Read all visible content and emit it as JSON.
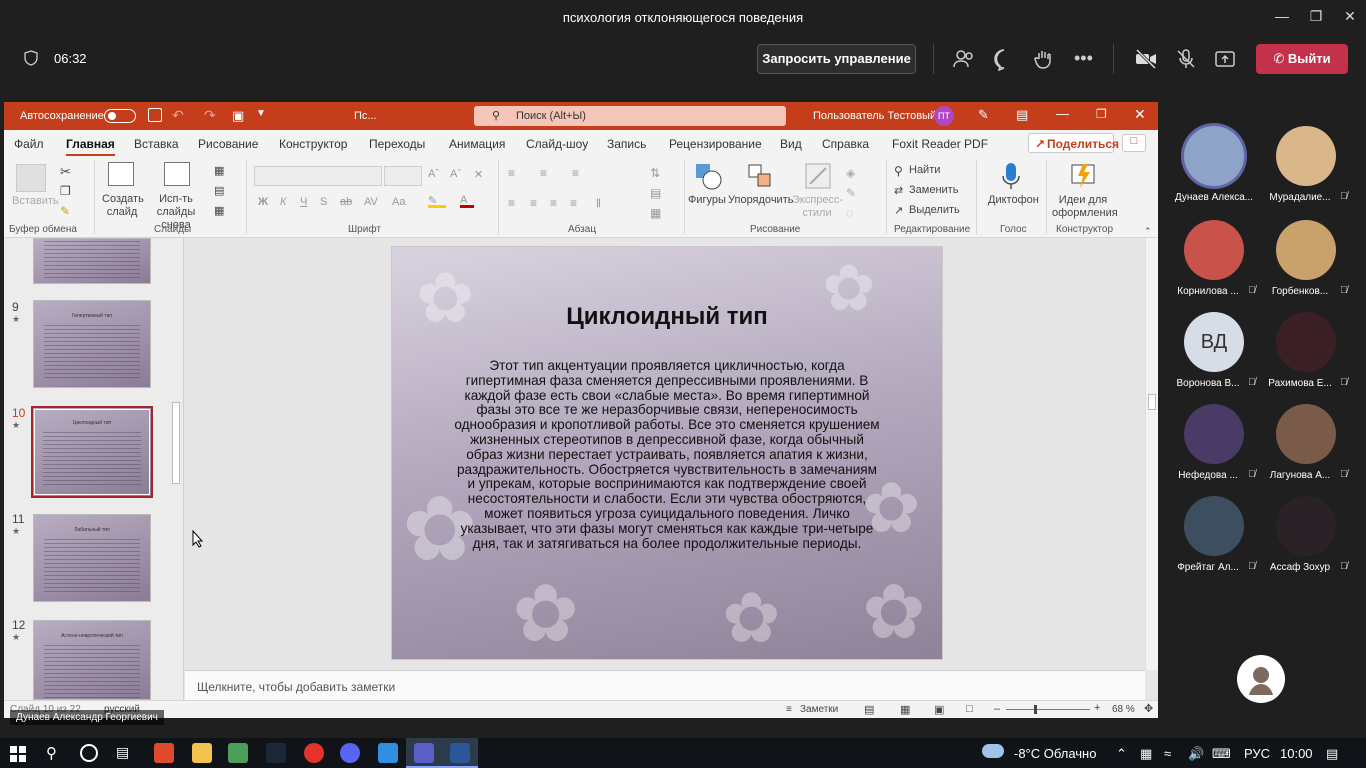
{
  "window": {
    "title": "психология отклоняющегося поведения"
  },
  "meeting": {
    "timer": "06:32",
    "request_control": "Запросить управление",
    "leave": "Выйти"
  },
  "powerpoint": {
    "autosave": "Автосохранение",
    "doc_name": "Пс...",
    "search_placeholder": "Поиск (Alt+Ы)",
    "user": "Пользователь Тестовый",
    "user_initials": "ПТ",
    "share": "Поделиться",
    "tabs": [
      "Файл",
      "Главная",
      "Вставка",
      "Рисование",
      "Конструктор",
      "Переходы",
      "Анимация",
      "Слайд-шоу",
      "Запись",
      "Рецензирование",
      "Вид",
      "Справка",
      "Foxit Reader PDF"
    ],
    "ribbon": {
      "paste": "Вставить",
      "create_slide": "Создать слайд",
      "reuse_slides": "Исп-ть слайды снова",
      "shapes": "Фигуры",
      "arrange": "Упорядочить",
      "express_styles": "Экспресс-стили",
      "find": "Найти",
      "replace": "Заменить",
      "select": "Выделить",
      "dictate": "Диктофон",
      "design_ideas": "Идеи для оформления",
      "groups": {
        "clipboard": "Буфер обмена",
        "slides": "Слайды",
        "font": "Шрифт",
        "paragraph": "Абзац",
        "drawing": "Рисование",
        "editing": "Редактирование",
        "voice": "Голос",
        "designer": "Конструктор"
      }
    },
    "thumbnails": [
      {
        "num": "9",
        "title": "Гипертимный тип"
      },
      {
        "num": "10",
        "title": "Циклоидный тип"
      },
      {
        "num": "11",
        "title": "Лабильный тип"
      },
      {
        "num": "12",
        "title": "Астено-невротический тип"
      }
    ],
    "slide": {
      "title": "Циклоидный тип",
      "body": "Этот тип акцентуации проявляется цикличностью, когда гипертимная фаза сменяется депрессивными проявлениями. В каждой фазе есть свои «слабые места». Во время гипертимной фазы это все те же неразборчивые связи, непереносимость однообразия и кропотливой работы. Все это сменяется крушением жизненных стереотипов в депрессивной фазе, когда обычный образ жизни перестает устраивать, появляется апатия к жизни, раздражительность. Обостряется чувствительность в замечаниям и упрекам, которые воспринимаются как подтверждение своей несостоятельности и слабости. Если эти чувства обостряются, может появиться угроза суицидального поведения. Личко указывает, что эти фазы могут сменяться как каждые три-четыре дня, так и затягиваться на более продолжительные периоды."
    },
    "notes_placeholder": "Щелкните, чтобы добавить заметки",
    "status": {
      "slide_counter": "Слайд 10 из 22",
      "language": "русский",
      "notes": "Заметки",
      "zoom": "68 %"
    }
  },
  "presenter_name": "Дунаев Александр Георгиевич",
  "participants": [
    {
      "name": "Дунаев Алекса...",
      "initials": "",
      "color": "#8da3c7"
    },
    {
      "name": "Мурадалие...",
      "initials": "",
      "color": "#d9b78a"
    },
    {
      "name": "Корнилова ...",
      "initials": "",
      "color": "#c9534a"
    },
    {
      "name": "Горбенков...",
      "initials": "",
      "color": "#c9a26b"
    },
    {
      "name": "Воронова В...",
      "initials": "ВД",
      "color": "#d7dde6"
    },
    {
      "name": "Рахимова Е...",
      "initials": "",
      "color": "#3a1f24"
    },
    {
      "name": "Нефедова ...",
      "initials": "",
      "color": "#4a3a66"
    },
    {
      "name": "Лагунова А...",
      "initials": "",
      "color": "#7a5a48"
    },
    {
      "name": "Фрейтаг Ал...",
      "initials": "",
      "color": "#3d4f5e"
    },
    {
      "name": "Ассаф Зохур",
      "initials": "",
      "color": "#2a2226"
    }
  ],
  "taskbar": {
    "weather": "-8°C Облачно",
    "lang": "РУС",
    "clock": "10:00"
  }
}
